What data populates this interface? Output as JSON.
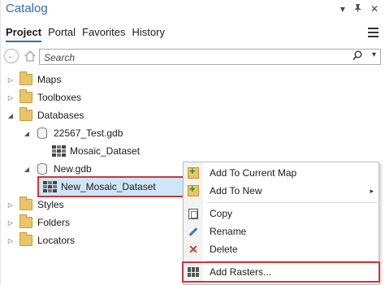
{
  "pane": {
    "title": "Catalog",
    "controls": [
      "▾",
      "📌",
      "✕"
    ]
  },
  "tabs": [
    {
      "label": "Project",
      "active": true
    },
    {
      "label": "Portal"
    },
    {
      "label": "Favorites"
    },
    {
      "label": "History"
    }
  ],
  "search": {
    "placeholder": "Search",
    "search_icon": "search-icon"
  },
  "tree": {
    "items": [
      {
        "label": "Maps",
        "icon": "folder-icon",
        "expand": "▷"
      },
      {
        "label": "Toolboxes",
        "icon": "folder-icon",
        "expand": "▷"
      },
      {
        "label": "Databases",
        "icon": "folder-icon",
        "expand": "◢"
      },
      {
        "label": "22567_Test.gdb",
        "icon": "geodatabase-icon",
        "expand": "◢"
      },
      {
        "label": "Mosaic_Dataset",
        "icon": "mosaic-dataset-icon",
        "expand": ""
      },
      {
        "label": "New.gdb",
        "icon": "geodatabase-icon",
        "expand": "◢"
      },
      {
        "label": "New_Mosaic_Dataset",
        "icon": "mosaic-dataset-icon",
        "expand": "",
        "selected": true
      },
      {
        "label": "Styles",
        "icon": "folder-icon",
        "expand": "▷"
      },
      {
        "label": "Folders",
        "icon": "folder-icon",
        "expand": "▷"
      },
      {
        "label": "Locators",
        "icon": "folder-icon",
        "expand": "▷"
      }
    ]
  },
  "context_menu": {
    "items": [
      {
        "label": "Add To Current Map",
        "icon": "add-to-map-icon"
      },
      {
        "label": "Add To New",
        "icon": "add-to-new-icon",
        "submenu": true
      },
      {
        "label": "Copy",
        "icon": "copy-icon"
      },
      {
        "label": "Rename",
        "icon": "rename-icon"
      },
      {
        "label": "Delete",
        "icon": "delete-icon"
      },
      {
        "label": "Add Rasters...",
        "icon": "add-rasters-icon",
        "highlighted": true
      }
    ]
  },
  "colors": {
    "accent": "#2a6fb6",
    "highlight_outline": "#c43a3a",
    "selection": "#cfe5f8",
    "folder": "#e9c46a"
  }
}
